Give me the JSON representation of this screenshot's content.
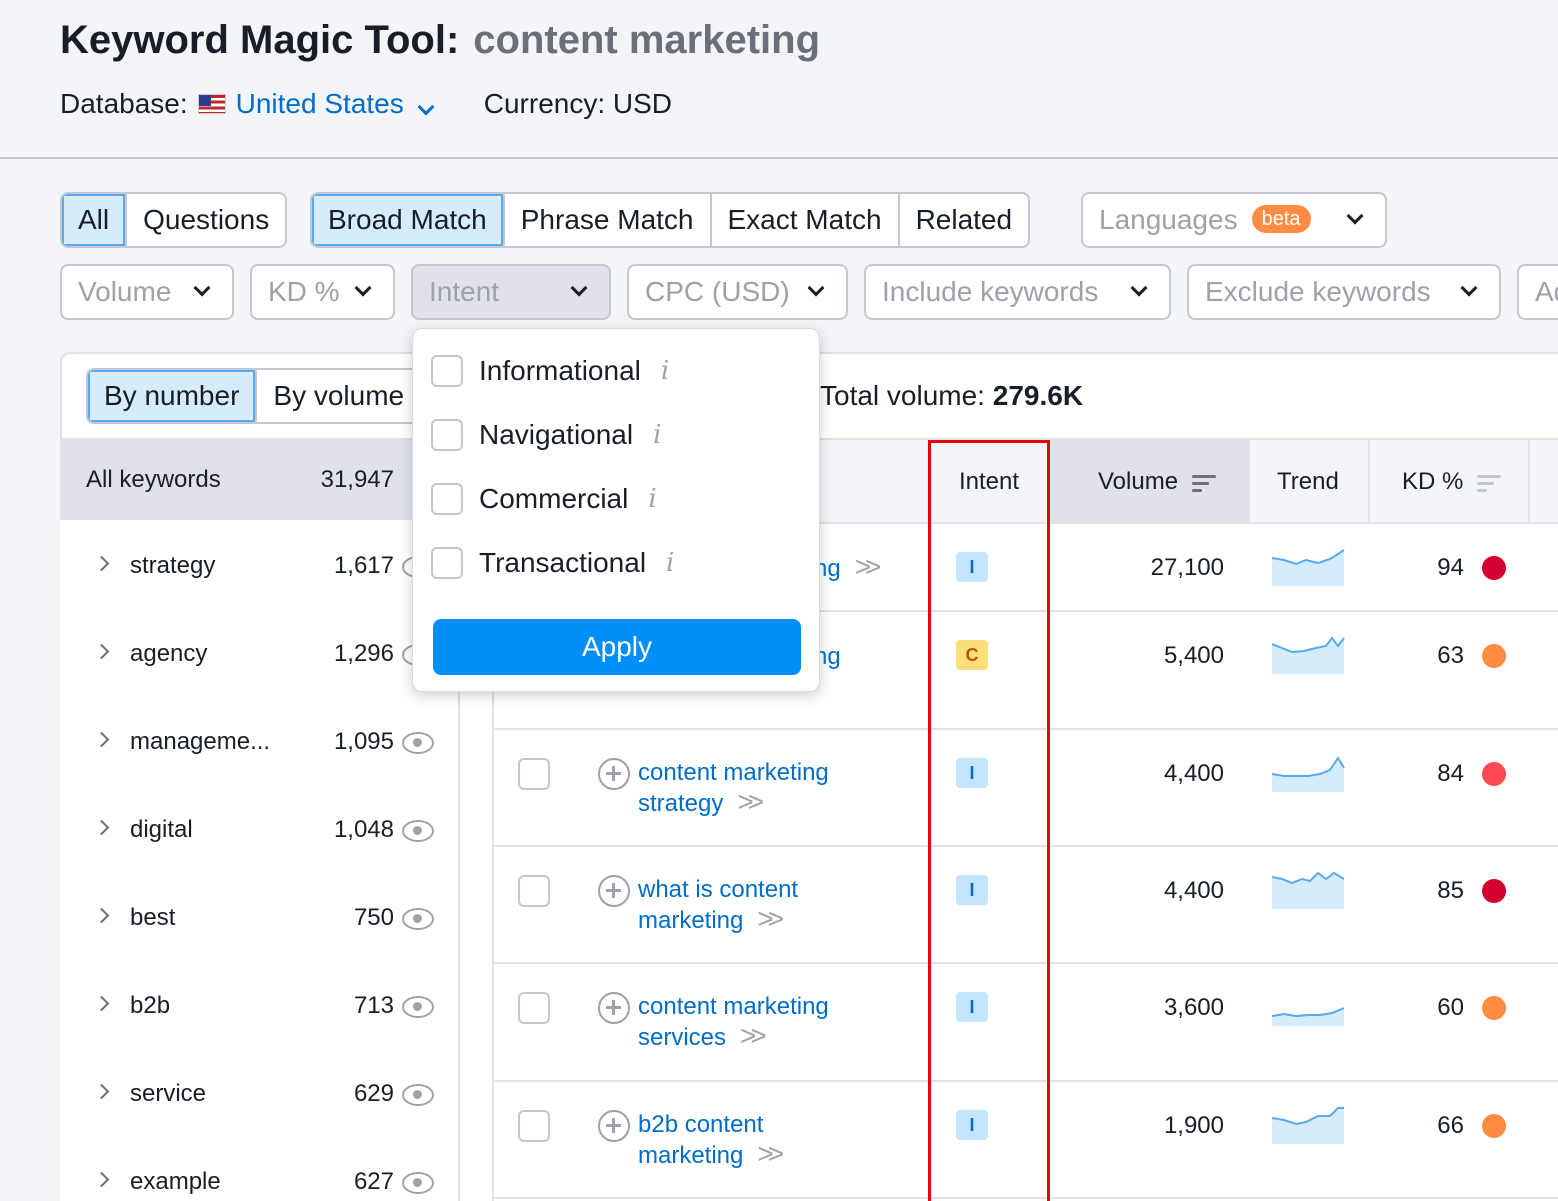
{
  "header": {
    "title": "Keyword Magic Tool:",
    "query": "content marketing",
    "database_label": "Database:",
    "database_value": "United States",
    "currency": "Currency: USD"
  },
  "tabs_type": [
    {
      "label": "All",
      "active": true
    },
    {
      "label": "Questions",
      "active": false
    }
  ],
  "tabs_match": [
    {
      "label": "Broad Match",
      "active": true
    },
    {
      "label": "Phrase Match",
      "active": false
    },
    {
      "label": "Exact Match",
      "active": false
    },
    {
      "label": "Related",
      "active": false
    }
  ],
  "languages": {
    "label": "Languages",
    "badge": "beta"
  },
  "filters": {
    "volume": "Volume",
    "kd": "KD %",
    "intent": "Intent",
    "cpc": "CPC (USD)",
    "include": "Include keywords",
    "exclude": "Exclude keywords",
    "advanced": "Ad"
  },
  "intent_dropdown": {
    "options": [
      "Informational",
      "Navigational",
      "Commercial",
      "Transactional"
    ],
    "info_glyph": "i",
    "apply_label": "Apply"
  },
  "view_toggle": {
    "by_number": "By number",
    "by_volume": "By volume"
  },
  "total_volume": {
    "label": "Total volume:",
    "value": "279.6K"
  },
  "sidebar": {
    "all_keywords_label": "All keywords",
    "all_keywords_count": "31,947",
    "items": [
      {
        "label": "strategy",
        "count": "1,617"
      },
      {
        "label": "agency",
        "count": "1,296"
      },
      {
        "label": "manageme...",
        "count": "1,095"
      },
      {
        "label": "digital",
        "count": "1,048"
      },
      {
        "label": "best",
        "count": "750"
      },
      {
        "label": "b2b",
        "count": "713"
      },
      {
        "label": "service",
        "count": "629"
      },
      {
        "label": "example",
        "count": "627"
      }
    ]
  },
  "table": {
    "columns": {
      "intent": "Intent",
      "volume": "Volume",
      "trend": "Trend",
      "kd": "KD %"
    },
    "rows": [
      {
        "kw1": "",
        "kw2": "ng",
        "intent": "I",
        "volume": "27,100",
        "kd": "94",
        "kd_color": "#d1002f"
      },
      {
        "kw1": "",
        "kw2": "ng",
        "intent": "C",
        "volume": "5,400",
        "kd": "63",
        "kd_color": "#ff8c42"
      },
      {
        "kw1": "content marketing",
        "kw2": "strategy",
        "intent": "I",
        "volume": "4,400",
        "kd": "84",
        "kd_color": "#ff4953"
      },
      {
        "kw1": "what is content",
        "kw2": "marketing",
        "intent": "I",
        "volume": "4,400",
        "kd": "85",
        "kd_color": "#d1002f"
      },
      {
        "kw1": "content marketing",
        "kw2": "services",
        "intent": "I",
        "volume": "3,600",
        "kd": "60",
        "kd_color": "#ff8c42"
      },
      {
        "kw1": "b2b content",
        "kw2": "marketing",
        "intent": "I",
        "volume": "1,900",
        "kd": "66",
        "kd_color": "#ff8c42"
      }
    ]
  },
  "colors": {
    "accent": "#006dca",
    "primary_button": "#008ff8",
    "highlight_box": "#e8000d",
    "active_tab": "#d5ecfc"
  }
}
